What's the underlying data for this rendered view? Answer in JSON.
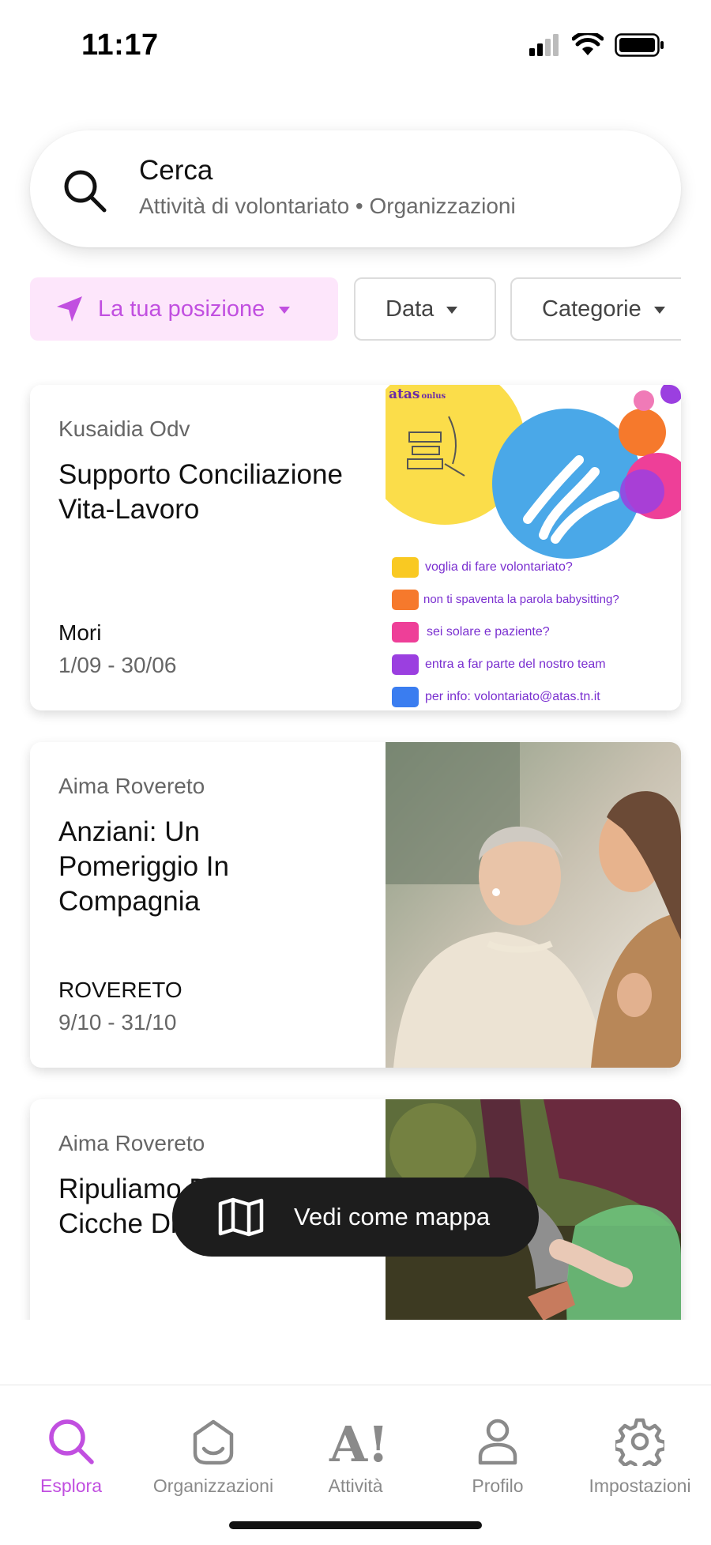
{
  "status_bar": {
    "time": "11:17"
  },
  "search": {
    "title": "Cerca",
    "subtitle": "Attività di volontariato • Organizzazioni"
  },
  "filters": {
    "location": "La tua posizione",
    "date": "Data",
    "categories": "Categorie"
  },
  "cards": [
    {
      "organization": "Kusaidia Odv",
      "title": "Supporto Conciliazione Vita-Lavoro",
      "place": "Mori",
      "dates": "1/09 - 30/06",
      "flyer": {
        "logo": "atas",
        "logo_sub": "onlus",
        "lines": [
          {
            "text": "voglia di fare volontariato?",
            "color": "#f9c922"
          },
          {
            "text": "non ti spaventa la parola babysitting?",
            "color": "#f6792c"
          },
          {
            "text": "sei solare e paziente?",
            "color": "#ee3f98"
          },
          {
            "text": "entra a far parte del nostro team",
            "color": "#9b3fe0"
          },
          {
            "text": "per info: volontariato@atas.tn.it",
            "color": "#3a7df0"
          }
        ]
      }
    },
    {
      "organization": "Aima Rovereto",
      "title": "Anziani: Un Pomeriggio In Compagnia",
      "place": "ROVERETO",
      "dates": "9/10 - 31/10"
    },
    {
      "organization": "Aima Rovereto",
      "title": "Ripuliamo Dalle Cicche Di Sigaretta",
      "place": "",
      "dates": ""
    }
  ],
  "map_button": {
    "label": "Vedi come mappa"
  },
  "tabs": [
    {
      "label": "Esplora",
      "icon": "search-icon",
      "active": true
    },
    {
      "label": "Organizzazioni",
      "icon": "organization-smile-icon",
      "active": false
    },
    {
      "label": "Attività",
      "icon": "activity-a-icon",
      "active": false
    },
    {
      "label": "Profilo",
      "icon": "profile-icon",
      "active": false
    },
    {
      "label": "Impostazioni",
      "icon": "gear-icon",
      "active": false
    }
  ],
  "colors": {
    "accent": "#c14fe0",
    "accent_bg": "#fde6fb",
    "map_button_bg": "#1d1d1d"
  }
}
